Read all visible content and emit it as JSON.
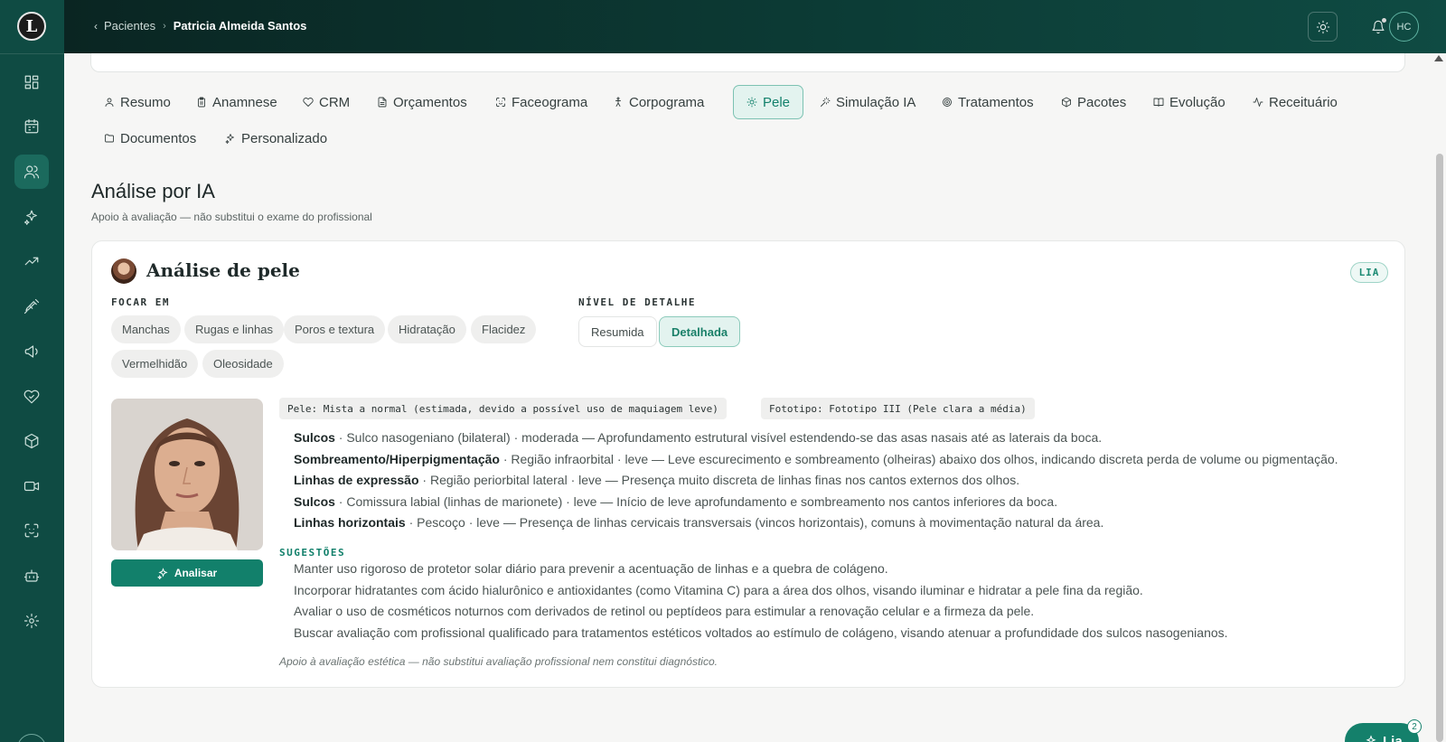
{
  "header": {
    "breadcrumb_back": "Pacientes",
    "breadcrumb_current": "Patricia Almeida Santos",
    "user_initials": "HC"
  },
  "sidebar": {
    "logo_letter": "L",
    "items": [
      {
        "icon": "dashboard-icon"
      },
      {
        "icon": "calendar-icon"
      },
      {
        "icon": "patients-icon",
        "active": true
      },
      {
        "icon": "sparkles-icon"
      },
      {
        "icon": "trending-up-icon"
      },
      {
        "icon": "syringe-icon"
      },
      {
        "icon": "megaphone-icon"
      },
      {
        "icon": "heart-handshake-icon"
      },
      {
        "icon": "package-icon"
      },
      {
        "icon": "video-icon"
      },
      {
        "icon": "face-scan-icon"
      },
      {
        "icon": "bot-icon"
      },
      {
        "icon": "settings-icon"
      }
    ]
  },
  "tabs": [
    {
      "label": "Resumo",
      "icon": "user-icon"
    },
    {
      "label": "Anamnese",
      "icon": "clipboard-icon"
    },
    {
      "label": "CRM",
      "icon": "heart-icon"
    },
    {
      "label": "Orçamentos",
      "icon": "file-icon"
    },
    {
      "label": "Faceograma",
      "icon": "face-scan-icon"
    },
    {
      "label": "Corpograma",
      "icon": "body-icon"
    },
    {
      "label": "Pele",
      "icon": "sun-icon",
      "active": true
    },
    {
      "label": "Simulação IA",
      "icon": "wand-icon"
    },
    {
      "label": "Tratamentos",
      "icon": "target-icon"
    },
    {
      "label": "Pacotes",
      "icon": "package-icon"
    },
    {
      "label": "Evolução",
      "icon": "book-icon"
    },
    {
      "label": "Receituário",
      "icon": "activity-icon"
    },
    {
      "label": "Documentos",
      "icon": "folder-icon"
    },
    {
      "label": "Personalizado",
      "icon": "sparkles-icon"
    }
  ],
  "section": {
    "title": "Análise por IA",
    "subtitle": "Apoio à avaliação — não substitui o exame do profissional"
  },
  "card": {
    "title": "Análise de pele",
    "badge": "LIA",
    "focus_label": "FOCAR EM",
    "focus_chips": [
      "Manchas",
      "Rugas e linhas",
      "Poros e textura",
      "Hidratação",
      "Flacidez",
      "Vermelhidão",
      "Oleosidade"
    ],
    "detail_label": "NÍVEL DE DETALHE",
    "detail_options": [
      {
        "label": "Resumida",
        "selected": false
      },
      {
        "label": "Detalhada",
        "selected": true
      }
    ],
    "analyze_button": "Analisar",
    "skin_type_tag": "Pele: Mista a normal (estimada, devido a possível uso de maquiagem leve)",
    "phototype_tag": "Fototipo: Fototipo III (Pele clara a média)",
    "findings": [
      {
        "title": "Sulcos",
        "detail": " · Sulco nasogeniano (bilateral) · moderada — Aprofundamento estrutural visível estendendo-se das asas nasais até as laterais da boca."
      },
      {
        "title": "Sombreamento/Hiperpigmentação",
        "detail": " · Região infraorbital · leve — Leve escurecimento e sombreamento (olheiras) abaixo dos olhos, indicando discreta perda de volume ou pigmentação."
      },
      {
        "title": "Linhas de expressão",
        "detail": " · Região periorbital lateral · leve — Presença muito discreta de linhas finas nos cantos externos dos olhos."
      },
      {
        "title": "Sulcos",
        "detail": " · Comissura labial (linhas de marionete) · leve — Início de leve aprofundamento e sombreamento nos cantos inferiores da boca."
      },
      {
        "title": "Linhas horizontais",
        "detail": " · Pescoço · leve — Presença de linhas cervicais transversais (vincos horizontais), comuns à movimentação natural da área."
      }
    ],
    "suggestions_label": "SUGESTÕES",
    "suggestions": [
      "Manter uso rigoroso de protetor solar diário para prevenir a acentuação de linhas e a quebra de colágeno.",
      "Incorporar hidratantes com ácido hialurônico e antioxidantes (como Vitamina C) para a área dos olhos, visando iluminar e hidratar a pele fina da região.",
      "Avaliar o uso de cosméticos noturnos com derivados de retinol ou peptídeos para estimular a renovação celular e a firmeza da pele.",
      "Buscar avaliação com profissional qualificado para tratamentos estéticos voltados ao estímulo de colágeno, visando atenuar a profundidade dos sulcos nasogenianos."
    ],
    "disclaimer": "Apoio à avaliação estética — não substitui avaliação profissional nem constitui diagnóstico."
  },
  "assistant": {
    "label": "Lia",
    "count": "2"
  },
  "colors": {
    "sidebar": "#0f4b43",
    "accent": "#12806b",
    "active_tab_bg": "#e3f3ef"
  }
}
